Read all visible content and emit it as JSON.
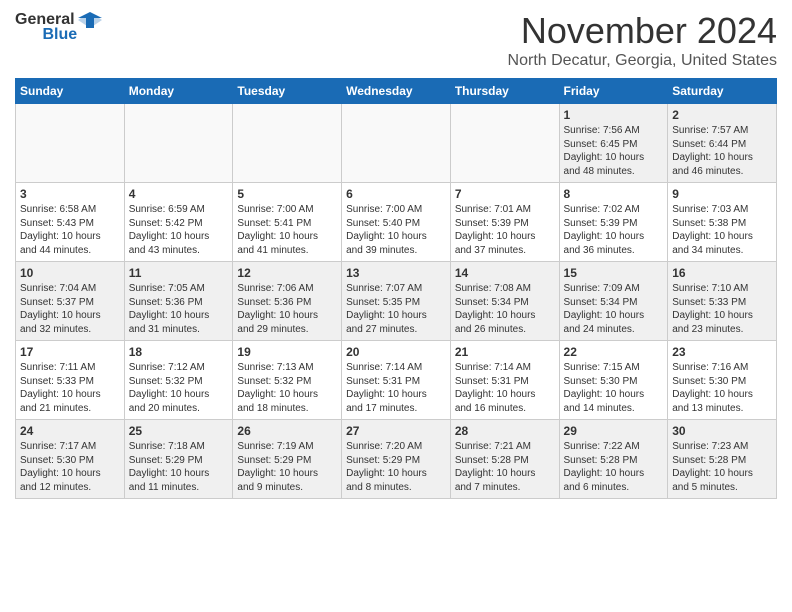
{
  "header": {
    "logo_general": "General",
    "logo_blue": "Blue",
    "title": "November 2024",
    "location": "North Decatur, Georgia, United States"
  },
  "days_of_week": [
    "Sunday",
    "Monday",
    "Tuesday",
    "Wednesday",
    "Thursday",
    "Friday",
    "Saturday"
  ],
  "weeks": [
    [
      {
        "day": "",
        "info": "",
        "empty": true
      },
      {
        "day": "",
        "info": "",
        "empty": true
      },
      {
        "day": "",
        "info": "",
        "empty": true
      },
      {
        "day": "",
        "info": "",
        "empty": true
      },
      {
        "day": "",
        "info": "",
        "empty": true
      },
      {
        "day": "1",
        "info": "Sunrise: 7:56 AM\nSunset: 6:45 PM\nDaylight: 10 hours\nand 48 minutes."
      },
      {
        "day": "2",
        "info": "Sunrise: 7:57 AM\nSunset: 6:44 PM\nDaylight: 10 hours\nand 46 minutes."
      }
    ],
    [
      {
        "day": "3",
        "info": "Sunrise: 6:58 AM\nSunset: 5:43 PM\nDaylight: 10 hours\nand 44 minutes."
      },
      {
        "day": "4",
        "info": "Sunrise: 6:59 AM\nSunset: 5:42 PM\nDaylight: 10 hours\nand 43 minutes."
      },
      {
        "day": "5",
        "info": "Sunrise: 7:00 AM\nSunset: 5:41 PM\nDaylight: 10 hours\nand 41 minutes."
      },
      {
        "day": "6",
        "info": "Sunrise: 7:00 AM\nSunset: 5:40 PM\nDaylight: 10 hours\nand 39 minutes."
      },
      {
        "day": "7",
        "info": "Sunrise: 7:01 AM\nSunset: 5:39 PM\nDaylight: 10 hours\nand 37 minutes."
      },
      {
        "day": "8",
        "info": "Sunrise: 7:02 AM\nSunset: 5:39 PM\nDaylight: 10 hours\nand 36 minutes."
      },
      {
        "day": "9",
        "info": "Sunrise: 7:03 AM\nSunset: 5:38 PM\nDaylight: 10 hours\nand 34 minutes."
      }
    ],
    [
      {
        "day": "10",
        "info": "Sunrise: 7:04 AM\nSunset: 5:37 PM\nDaylight: 10 hours\nand 32 minutes."
      },
      {
        "day": "11",
        "info": "Sunrise: 7:05 AM\nSunset: 5:36 PM\nDaylight: 10 hours\nand 31 minutes."
      },
      {
        "day": "12",
        "info": "Sunrise: 7:06 AM\nSunset: 5:36 PM\nDaylight: 10 hours\nand 29 minutes."
      },
      {
        "day": "13",
        "info": "Sunrise: 7:07 AM\nSunset: 5:35 PM\nDaylight: 10 hours\nand 27 minutes."
      },
      {
        "day": "14",
        "info": "Sunrise: 7:08 AM\nSunset: 5:34 PM\nDaylight: 10 hours\nand 26 minutes."
      },
      {
        "day": "15",
        "info": "Sunrise: 7:09 AM\nSunset: 5:34 PM\nDaylight: 10 hours\nand 24 minutes."
      },
      {
        "day": "16",
        "info": "Sunrise: 7:10 AM\nSunset: 5:33 PM\nDaylight: 10 hours\nand 23 minutes."
      }
    ],
    [
      {
        "day": "17",
        "info": "Sunrise: 7:11 AM\nSunset: 5:33 PM\nDaylight: 10 hours\nand 21 minutes."
      },
      {
        "day": "18",
        "info": "Sunrise: 7:12 AM\nSunset: 5:32 PM\nDaylight: 10 hours\nand 20 minutes."
      },
      {
        "day": "19",
        "info": "Sunrise: 7:13 AM\nSunset: 5:32 PM\nDaylight: 10 hours\nand 18 minutes."
      },
      {
        "day": "20",
        "info": "Sunrise: 7:14 AM\nSunset: 5:31 PM\nDaylight: 10 hours\nand 17 minutes."
      },
      {
        "day": "21",
        "info": "Sunrise: 7:14 AM\nSunset: 5:31 PM\nDaylight: 10 hours\nand 16 minutes."
      },
      {
        "day": "22",
        "info": "Sunrise: 7:15 AM\nSunset: 5:30 PM\nDaylight: 10 hours\nand 14 minutes."
      },
      {
        "day": "23",
        "info": "Sunrise: 7:16 AM\nSunset: 5:30 PM\nDaylight: 10 hours\nand 13 minutes."
      }
    ],
    [
      {
        "day": "24",
        "info": "Sunrise: 7:17 AM\nSunset: 5:30 PM\nDaylight: 10 hours\nand 12 minutes."
      },
      {
        "day": "25",
        "info": "Sunrise: 7:18 AM\nSunset: 5:29 PM\nDaylight: 10 hours\nand 11 minutes."
      },
      {
        "day": "26",
        "info": "Sunrise: 7:19 AM\nSunset: 5:29 PM\nDaylight: 10 hours\nand 9 minutes."
      },
      {
        "day": "27",
        "info": "Sunrise: 7:20 AM\nSunset: 5:29 PM\nDaylight: 10 hours\nand 8 minutes."
      },
      {
        "day": "28",
        "info": "Sunrise: 7:21 AM\nSunset: 5:28 PM\nDaylight: 10 hours\nand 7 minutes."
      },
      {
        "day": "29",
        "info": "Sunrise: 7:22 AM\nSunset: 5:28 PM\nDaylight: 10 hours\nand 6 minutes."
      },
      {
        "day": "30",
        "info": "Sunrise: 7:23 AM\nSunset: 5:28 PM\nDaylight: 10 hours\nand 5 minutes."
      }
    ]
  ],
  "row_shades": [
    true,
    false,
    true,
    false,
    true
  ]
}
